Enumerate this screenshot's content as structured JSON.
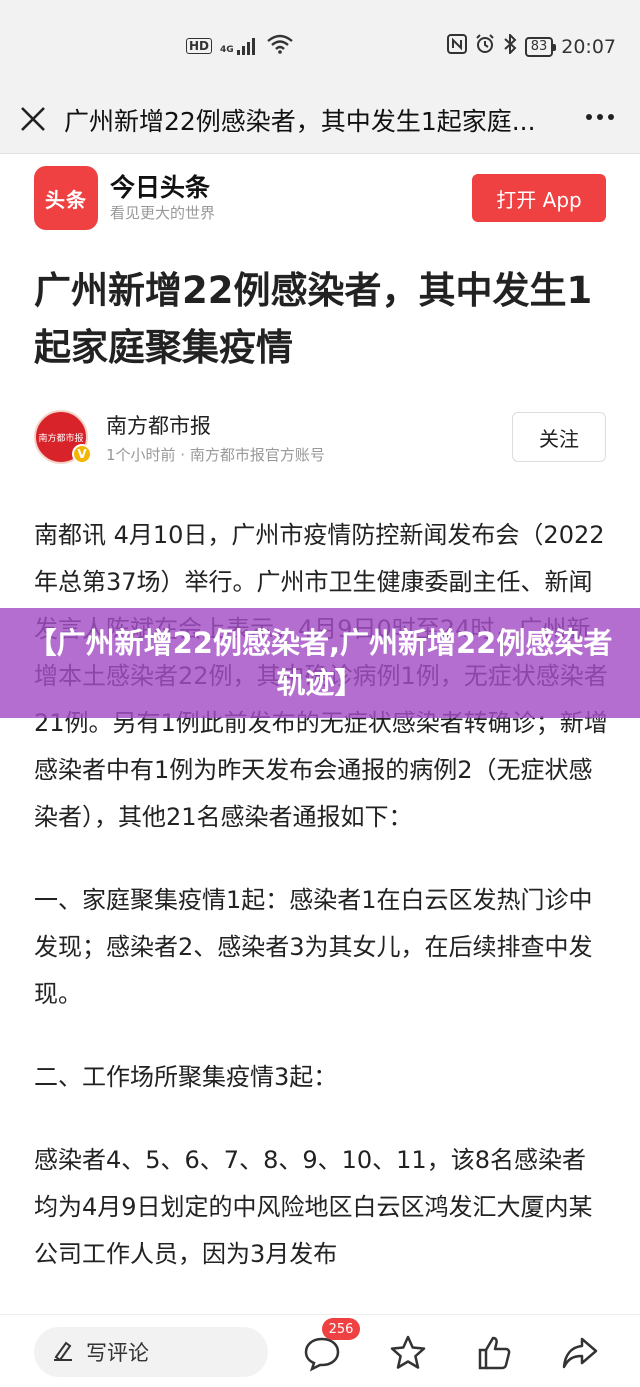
{
  "status_bar": {
    "network": "HD",
    "signal": "4G",
    "battery": "83",
    "time": "20:07"
  },
  "nav": {
    "title": "广州新增22例感染者，其中发生1起家庭..."
  },
  "app_banner": {
    "logo_text": "头条",
    "app_name": "今日头条",
    "slogan": "看见更大的世界",
    "open_button": "打开 App"
  },
  "article": {
    "headline": "广州新增22例感染者，其中发生1起家庭聚集疫情",
    "author": {
      "avatar_text": "南方都市报",
      "name": "南方都市报",
      "meta": "1个小时前 · 南方都市报官方账号",
      "follow_label": "关注"
    },
    "paragraphs": [
      "南都讯 4月10日，广州市疫情防控新闻发布会（2022年总第37场）举行。广州市卫生健康委副主任、新闻发言人陈斌在会上表示，4月9日0时至24时，广州新增本土感染者22例，其中确诊病例1例，无症状感染者21例。另有1例此前发布的无症状感染者转确诊；新增感染者中有1例为昨天发布会通报的病例2（无症状感染者），其他21名感染者通报如下：",
      "一、家庭聚集疫情1起：感染者1在白云区发热门诊中发现；感染者2、感染者3为其女儿，在后续排查中发现。",
      "二、工作场所聚集疫情3起：",
      "感染者4、5、6、7、8、9、10、11，该8名感染者均为4月9日划定的中风险地区白云区鸿发汇大厦内某公司工作人员，因为3月发布"
    ]
  },
  "overlay": {
    "text": "【广州新增22例感染者,广州新增22例感染者轨迹】"
  },
  "bottom_bar": {
    "comment_placeholder": "写评论",
    "comment_count": "256"
  }
}
